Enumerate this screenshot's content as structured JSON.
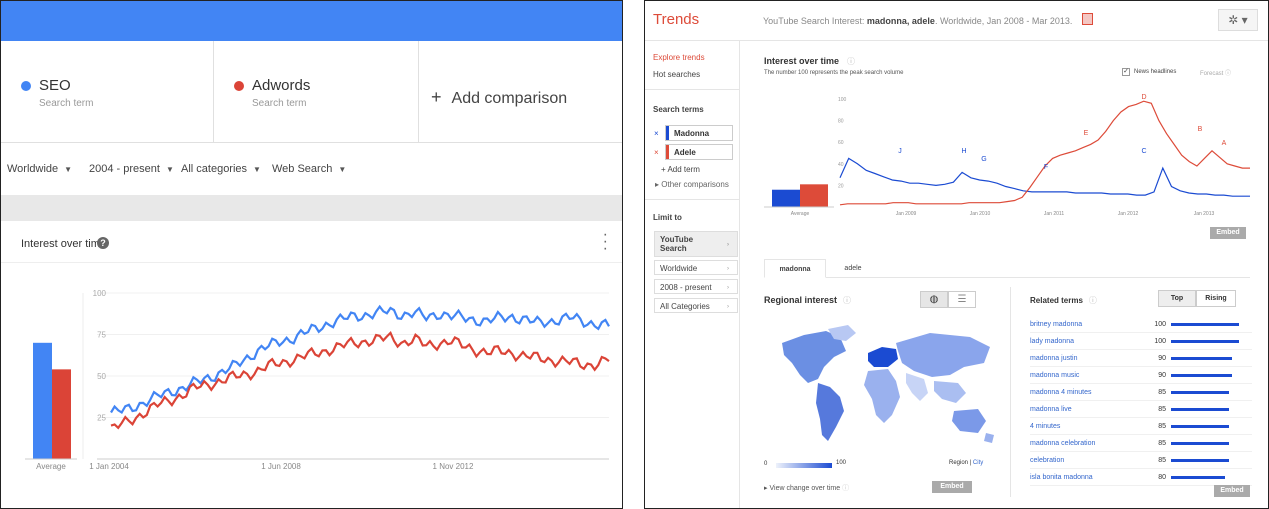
{
  "left": {
    "terms": [
      {
        "name": "SEO",
        "sub": "Search term",
        "color": "#4285f4"
      },
      {
        "name": "Adwords",
        "sub": "Search term",
        "color": "#db4437"
      }
    ],
    "add_comparison": "Add comparison",
    "filters": [
      "Worldwide",
      "2004 - present",
      "All categories",
      "Web Search"
    ],
    "interest_title": "Interest over time",
    "help_icon": "?"
  },
  "right": {
    "logo": "Trends",
    "title_prefix": "YouTube Search Interest: ",
    "title_terms": "madonna, adele",
    "title_suffix": ". Worldwide, Jan 2008 - Mar 2013.",
    "sidebar": {
      "explore": "Explore trends",
      "hot": "Hot searches",
      "search_terms_label": "Search terms",
      "terms": [
        {
          "name": "Madonna",
          "color": "#1b4bd2"
        },
        {
          "name": "Adele",
          "color": "#dd4b39"
        }
      ],
      "add_term": "+ Add term",
      "other": "Other comparisons",
      "limit_to": "Limit to",
      "limits": [
        "YouTube Search",
        "Worldwide",
        "2008 - present",
        "All Categories"
      ]
    },
    "interest": {
      "title": "Interest over time",
      "subtitle": "The number 100 represents the peak search volume",
      "news": "News headlines",
      "forecast": "Forecast",
      "embed": "Embed"
    },
    "tabs": [
      "madonna",
      "adele"
    ],
    "regional": {
      "title": "Regional interest",
      "scale_min": "0",
      "scale_max": "100",
      "region_label": "Region",
      "city_label": "City",
      "view_change": "View change over time",
      "embed": "Embed"
    },
    "related": {
      "title": "Related terms",
      "top": "Top",
      "rising": "Rising",
      "rows": [
        {
          "term": "britney madonna",
          "value": 100
        },
        {
          "term": "lady madonna",
          "value": 100
        },
        {
          "term": "madonna justin",
          "value": 90
        },
        {
          "term": "madonna music",
          "value": 90
        },
        {
          "term": "madonna 4 minutes",
          "value": 85
        },
        {
          "term": "madonna live",
          "value": 85
        },
        {
          "term": "4 minutes",
          "value": 85
        },
        {
          "term": "madonna celebration",
          "value": 85
        },
        {
          "term": "celebration",
          "value": 85
        },
        {
          "term": "isla bonita madonna",
          "value": 80
        }
      ],
      "embed": "Embed"
    }
  },
  "chart_data": [
    {
      "type": "line",
      "title": "Interest over time",
      "x_ticks": [
        "1 Jan 2004",
        "1 Jun 2008",
        "1 Nov 2012"
      ],
      "y_ticks": [
        25,
        50,
        75,
        100
      ],
      "ylim": [
        0,
        100
      ],
      "x_range": [
        "2004-01",
        "2016-06"
      ],
      "series": [
        {
          "name": "SEO",
          "color": "#4285f4",
          "average": 70,
          "values": [
            28,
            29,
            32,
            35,
            38,
            41,
            43,
            46,
            49,
            52,
            55,
            60,
            65,
            68,
            71,
            73,
            76,
            79,
            82,
            84,
            86,
            87,
            88,
            89,
            87,
            88,
            85,
            88,
            86,
            85,
            84,
            83,
            85,
            86,
            84,
            82,
            83,
            84,
            85,
            83,
            81,
            80
          ]
        },
        {
          "name": "Adwords",
          "color": "#db4437",
          "average": 54,
          "values": [
            18,
            21,
            25,
            29,
            33,
            36,
            39,
            43,
            45,
            47,
            49,
            51,
            53,
            56,
            58,
            60,
            62,
            64,
            66,
            68,
            70,
            71,
            72,
            73,
            70,
            72,
            68,
            70,
            71,
            68,
            66,
            64,
            65,
            64,
            62,
            61,
            60,
            59,
            58,
            57,
            57,
            60
          ]
        }
      ]
    },
    {
      "type": "line",
      "title": "Interest over time",
      "subtitle": "The number 100 represents the peak search volume",
      "x_ticks": [
        "Jan 2009",
        "Jan 2010",
        "Jan 2011",
        "Jan 2012",
        "Jan 2013"
      ],
      "y_ticks": [
        20,
        40,
        60,
        80,
        100
      ],
      "ylim": [
        0,
        100
      ],
      "series": [
        {
          "name": "Madonna",
          "color": "#1b4bd2",
          "average": 16,
          "values": [
            27,
            45,
            40,
            34,
            31,
            28,
            25,
            24,
            22,
            22,
            21,
            20,
            21,
            23,
            32,
            27,
            25,
            24,
            22,
            19,
            17,
            15,
            14,
            14,
            14,
            14,
            14,
            13,
            13,
            13,
            13,
            12,
            12,
            12,
            11,
            11,
            14,
            36,
            19,
            15,
            13,
            12,
            12,
            11,
            11,
            10,
            10,
            10
          ]
        },
        {
          "name": "Adele",
          "color": "#dd4b39",
          "average": 21,
          "values": [
            2,
            3,
            3,
            3,
            3,
            3,
            3,
            4,
            4,
            4,
            3,
            3,
            3,
            3,
            3,
            3,
            3,
            4,
            4,
            4,
            4,
            4,
            5,
            6,
            9,
            18,
            28,
            38,
            45,
            48,
            50,
            52,
            55,
            58,
            62,
            70,
            80,
            88,
            93,
            95,
            98,
            96,
            80,
            68,
            58,
            48,
            42,
            38,
            45,
            52,
            46,
            40,
            38,
            36,
            36
          ]
        }
      ],
      "annotations": [
        "J",
        "H",
        "G",
        "F",
        "E",
        "D",
        "C",
        "B",
        "A"
      ]
    }
  ]
}
